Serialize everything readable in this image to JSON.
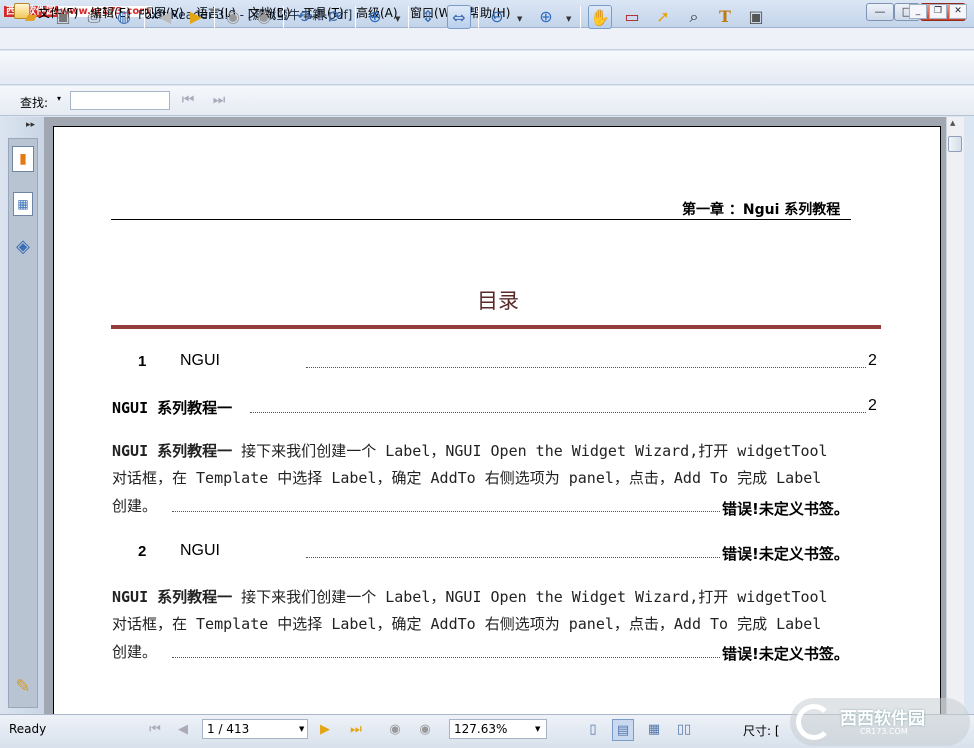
{
  "window": {
    "watermark_site": "西西软件园",
    "watermark_url": "www.cr173.com",
    "title": "Foxit Reader 3.0 - [游戏蛮牛书籍.pdf]",
    "controls": {
      "minimize": "—",
      "maximize": "□",
      "close": "✕"
    }
  },
  "menu": {
    "items": [
      "文件(F)",
      "编辑(E)",
      "视图(V)",
      "语言(L)",
      "文档(D)",
      "工具(T)",
      "高级(A)",
      "窗口(W)",
      "帮助(H)"
    ],
    "mdi": {
      "minimize": "_",
      "restore": "❐",
      "close": "✕"
    }
  },
  "toolbar": {
    "icons": [
      "open-icon",
      "save-icon",
      "print-icon",
      "email-icon",
      "prev-arrow-icon",
      "next-arrow-icon",
      "back-icon",
      "forward-icon",
      "rotate-left-icon",
      "rotate-right-icon",
      "zoom-in-tool-icon",
      "fit-page-icon",
      "fit-width-icon",
      "zoom-out-icon",
      "zoom-in-icon",
      "hand-tool-icon",
      "text-select-icon",
      "arrow-select-icon",
      "find-icon",
      "typewriter-icon",
      "snapshot-icon"
    ]
  },
  "findbar": {
    "label": "查找:",
    "dropdown": "▾",
    "input_value": ""
  },
  "document": {
    "header": "第一章 ：Ngui 系列教程",
    "toc_title": "目录",
    "entries": [
      {
        "num": "1",
        "text": "NGUI",
        "page": "2"
      },
      {
        "text": "NGUI 系列教程一",
        "page": "2"
      }
    ],
    "paragraph1": {
      "bold": "NGUI 系列教程一",
      "line1": " 接下来我们创建一个 Label，NGUI Open the Widget Wizard,打开 widgetTool",
      "line2": "对话框，在 Template 中选择 Label，确定 AddTo 右侧选项为 panel，点击，Add To 完成 Label",
      "line3": "创建。",
      "err": "错误!未定义书签。"
    },
    "entry2": {
      "num": "2",
      "text": "NGUI",
      "err": "错误!未定义书签。"
    },
    "paragraph2": {
      "bold": "NGUI 系列教程一",
      "line1": " 接下来我们创建一个 Label，NGUI Open the Widget Wizard,打开 widgetTool",
      "line2": "对话框，在 Template 中选择 Label，确定 AddTo 右侧选项为 panel，点击，Add To 完成 Label",
      "line3": "创建。",
      "err": "错误!未定义书签。"
    }
  },
  "statusbar": {
    "ready": "Ready",
    "page": "1 / 413",
    "zoom": "127.63%",
    "size_label": "尺寸: [",
    "logo_text": "西西软件园",
    "logo_sub": "CR173.COM"
  }
}
